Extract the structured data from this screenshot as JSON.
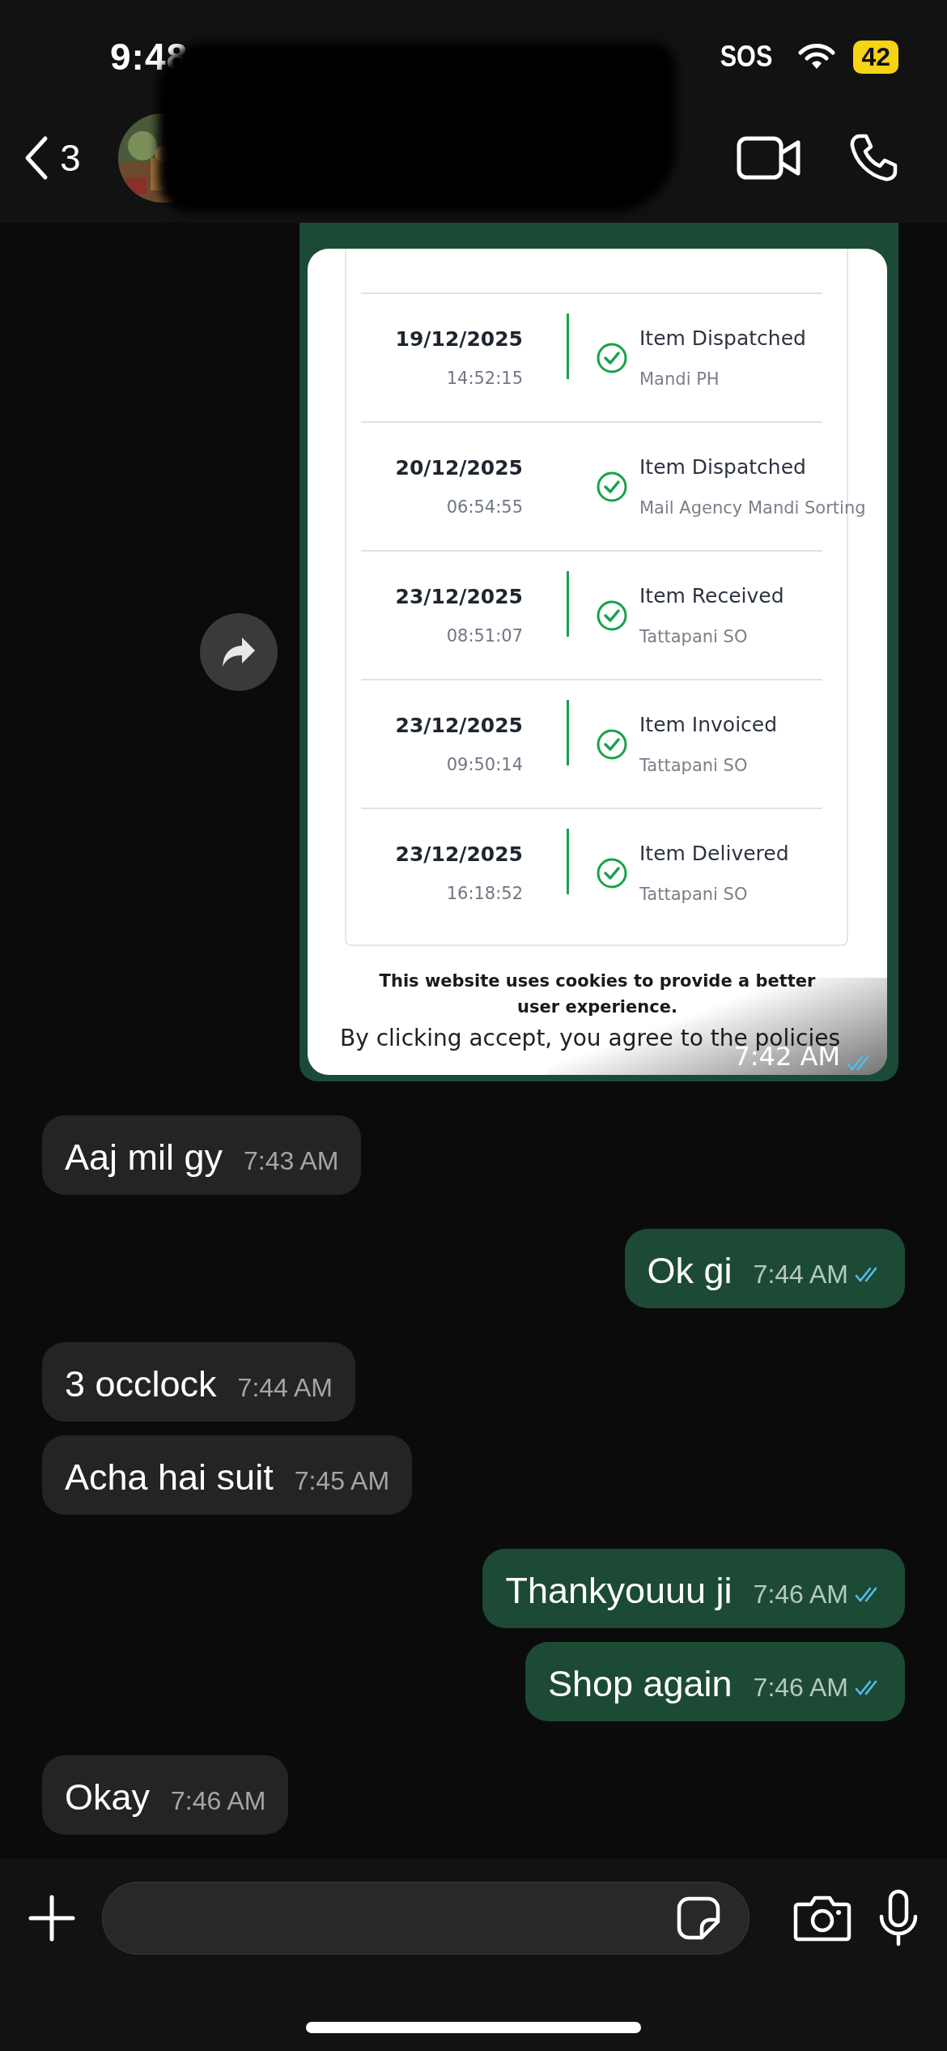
{
  "status_bar": {
    "time": "9:48",
    "sos": "SOS",
    "battery": "42"
  },
  "header": {
    "unread_count": "3"
  },
  "messages": [
    {
      "sent": true,
      "time": "7:42 AM",
      "read": true,
      "tracking": [
        {
          "date": "19/12/2025",
          "clock": "14:52:15",
          "event": "Item Dispatched",
          "office": "Mandi PH"
        },
        {
          "date": "20/12/2025",
          "clock": "06:54:55",
          "event": "Item Dispatched",
          "office": "Mail Agency Mandi Sorting"
        },
        {
          "date": "23/12/2025",
          "clock": "08:51:07",
          "event": "Item Received",
          "office": "Tattapani SO"
        },
        {
          "date": "23/12/2025",
          "clock": "09:50:14",
          "event": "Item Invoiced",
          "office": "Tattapani SO"
        },
        {
          "date": "23/12/2025",
          "clock": "16:18:52",
          "event": "Item Delivered",
          "office": "Tattapani SO"
        }
      ],
      "cookie_title": "This website uses cookies to provide a better user experience.",
      "cookie_text": "By clicking accept, you agree to the policies"
    },
    {
      "kind": "text",
      "sent": false,
      "text": "Aaj mil gy",
      "time": "7:43 AM"
    },
    {
      "kind": "text",
      "sent": true,
      "text": "Ok gi",
      "time": "7:44 AM",
      "read": true
    },
    {
      "kind": "text",
      "sent": false,
      "text": "3 occlock",
      "time": "7:44 AM"
    },
    {
      "kind": "text",
      "sent": false,
      "text": "Acha hai suit",
      "time": "7:45 AM"
    },
    {
      "kind": "text",
      "sent": true,
      "text": "Thankyouuu ji",
      "time": "7:46 AM",
      "read": true
    },
    {
      "kind": "text",
      "sent": true,
      "text": "Shop again",
      "time": "7:46 AM",
      "read": true
    },
    {
      "kind": "text",
      "sent": false,
      "text": "Okay",
      "time": "7:46 AM"
    }
  ]
}
